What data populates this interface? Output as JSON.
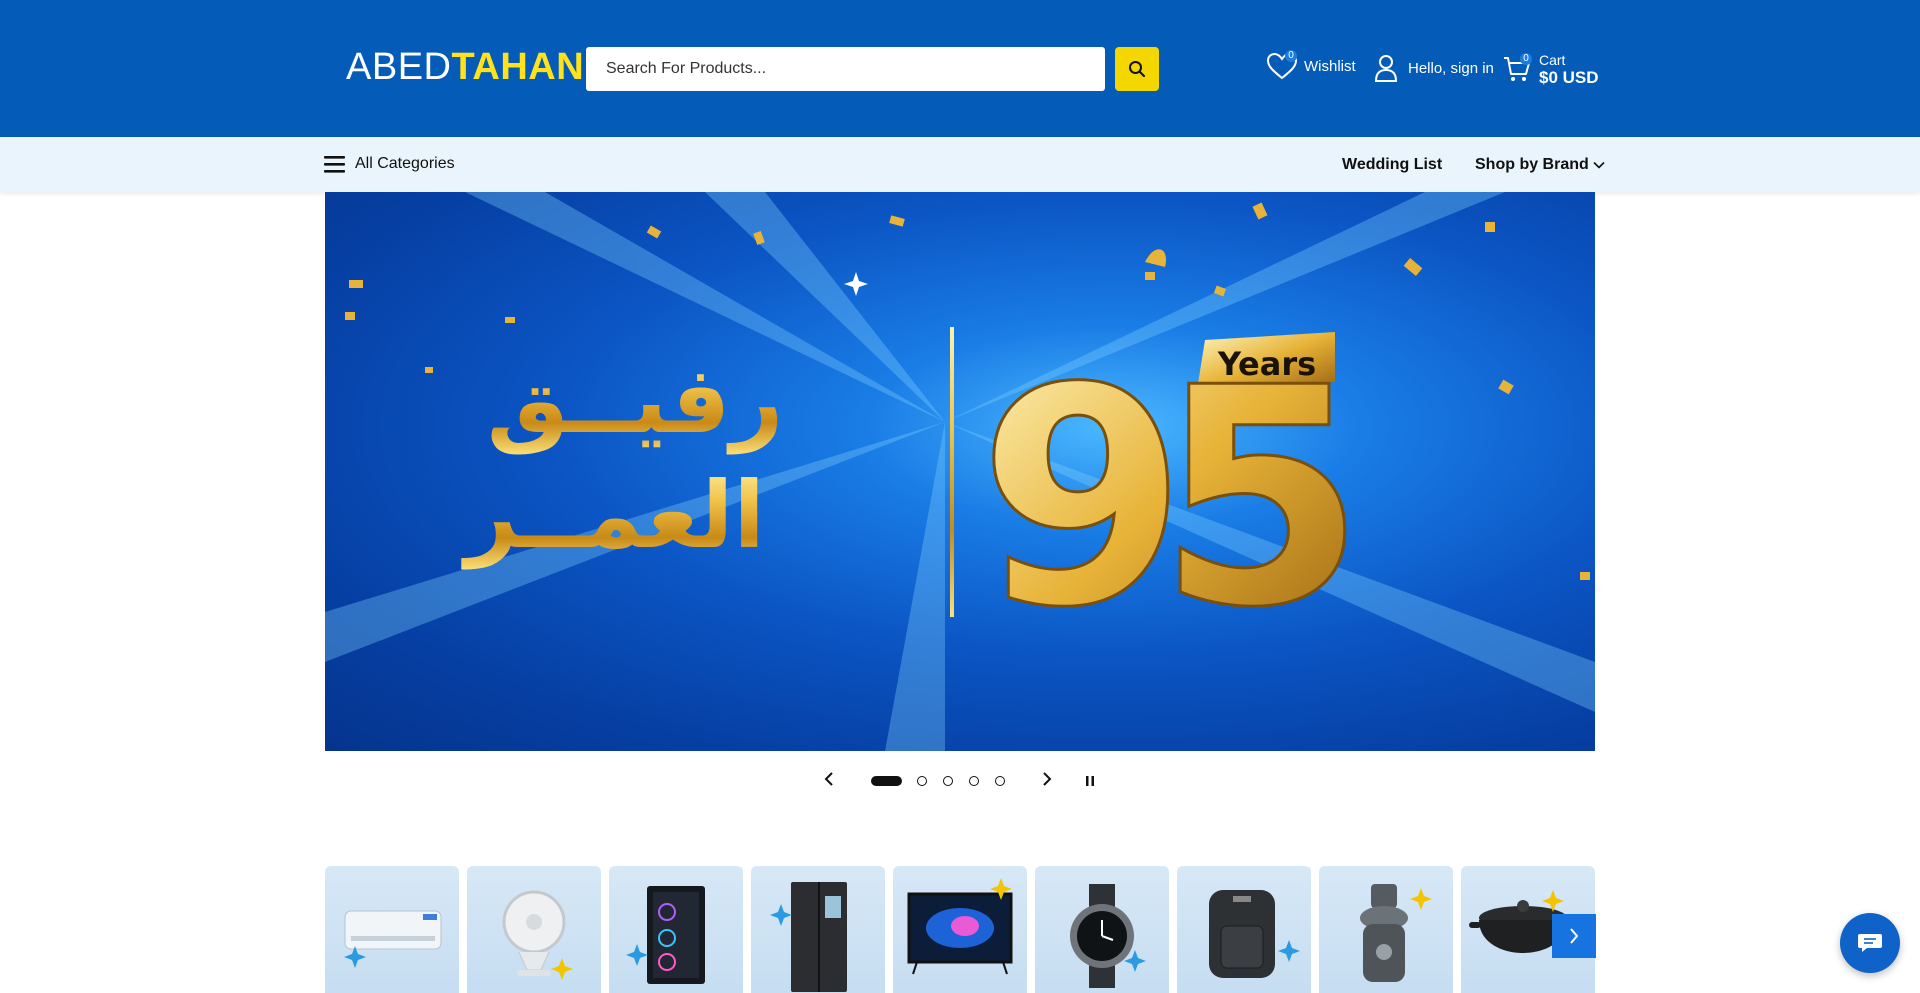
{
  "header": {
    "logo_part1": "ABED",
    "logo_part2": "TAHAN",
    "search_placeholder": "Search For Products...",
    "wishlist_label": "Wishlist",
    "wishlist_count": "0",
    "signin_label": "Hello, sign in",
    "cart_label": "Cart",
    "cart_count": "0",
    "cart_total": "$0 USD",
    "colors": {
      "bar": "#045bb8",
      "accent": "#ffe21c"
    }
  },
  "nav": {
    "all_categories": "All Categories",
    "wedding_list": "Wedding List",
    "shop_by_brand": "Shop by Brand"
  },
  "hero": {
    "years_label": "Years",
    "number": "95",
    "arabic_line1": "رفيــق",
    "arabic_line2": "العمــر"
  },
  "carousel": {
    "slide_count": 5,
    "active_index": 0
  },
  "categories": [
    {
      "icon": "air-conditioner-icon"
    },
    {
      "icon": "fan-icon"
    },
    {
      "icon": "gaming-pc-icon"
    },
    {
      "icon": "refrigerator-icon"
    },
    {
      "icon": "television-icon"
    },
    {
      "icon": "smartwatch-icon"
    },
    {
      "icon": "air-fryer-icon"
    },
    {
      "icon": "juicer-icon"
    },
    {
      "icon": "cookware-pot-icon"
    }
  ]
}
